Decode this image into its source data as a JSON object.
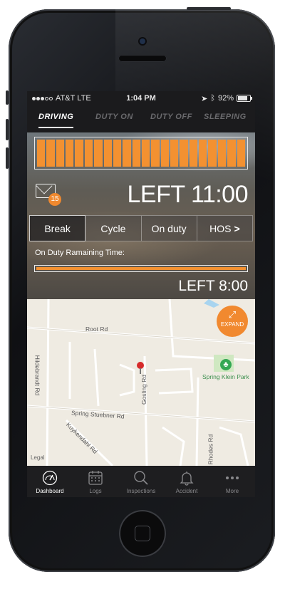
{
  "status_bar": {
    "carrier": "AT&T",
    "network": "LTE",
    "time": "1:04 PM",
    "battery": "92%",
    "battery_level": 0.92
  },
  "tabs": [
    {
      "label": "DRIVING",
      "active": true
    },
    {
      "label": "DUTY ON",
      "active": false
    },
    {
      "label": "DUTY OFF",
      "active": false
    },
    {
      "label": "SLEEPING",
      "active": false
    }
  ],
  "driving": {
    "progress_segments_total": 22,
    "progress_segments_filled": 22,
    "messages_badge": "15",
    "left_main": "LEFT 11:00"
  },
  "subtabs": [
    {
      "label": "Break",
      "active": true
    },
    {
      "label": "Cycle",
      "active": false
    },
    {
      "label": "On duty",
      "active": false
    },
    {
      "label": "HOS",
      "active": false,
      "chevron": ">"
    }
  ],
  "on_duty": {
    "label": "On Duty Ramaining Time:",
    "fill_fraction": 1.0,
    "left_small": "LEFT 8:00"
  },
  "map": {
    "expand_label": "EXPAND",
    "legal": "Legal",
    "roads": {
      "root": "Root Rd",
      "hildebrandt": "Hildebrandt Rd",
      "gosling": "Gosling Rd",
      "spring_stuebner": "Spring Stuebner Rd",
      "kuykendahl": "Kuykendahl Rd",
      "rhodes": "Rhodes Rd"
    },
    "park": "Spring Klein Park"
  },
  "nav": [
    {
      "label": "Dashboard",
      "icon": "gauge-icon",
      "active": true
    },
    {
      "label": "Logs",
      "icon": "calendar-icon",
      "active": false
    },
    {
      "label": "Inspections",
      "icon": "search-icon",
      "active": false
    },
    {
      "label": "Accident",
      "icon": "bell-icon",
      "active": false
    },
    {
      "label": "More",
      "icon": "more-icon",
      "active": false
    }
  ],
  "colors": {
    "accent": "#f39131",
    "badge": "#f0892f",
    "park": "#34a853"
  }
}
